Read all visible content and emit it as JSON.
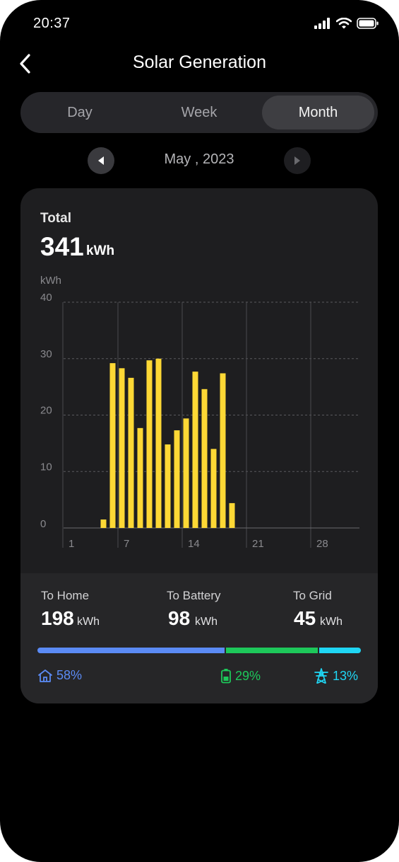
{
  "status": {
    "time": "20:37"
  },
  "header": {
    "title": "Solar Generation",
    "back_icon": "chevron-left-icon"
  },
  "tabs": [
    {
      "label": "Day",
      "active": false
    },
    {
      "label": "Week",
      "active": false
    },
    {
      "label": "Month",
      "active": true
    }
  ],
  "period": {
    "label": "May , 2023",
    "prev_icon": "triangle-left-icon",
    "next_icon": "triangle-right-icon"
  },
  "summary": {
    "title": "Total",
    "value": "341",
    "unit": "kWh"
  },
  "chart_data": {
    "type": "bar",
    "ylabel": "kWh",
    "ylim": [
      0,
      40
    ],
    "yticks": [
      "0",
      "10",
      "20",
      "30",
      "40"
    ],
    "xticks": [
      "1",
      "7",
      "14",
      "21",
      "28"
    ],
    "grid": true,
    "bar_color": "#FDD835",
    "x": [
      1,
      2,
      3,
      4,
      5,
      6,
      7,
      8,
      9,
      10,
      11,
      12,
      13,
      14,
      15,
      16,
      17,
      18,
      19,
      20,
      21,
      22,
      23,
      24,
      25,
      26,
      27,
      28,
      29,
      30,
      31
    ],
    "values": [
      0,
      0,
      0,
      0,
      1.5,
      29.2,
      28.3,
      26.6,
      17.7,
      29.7,
      30,
      14.8,
      17.3,
      19.4,
      27.7,
      24.6,
      14,
      27.4,
      4.4,
      0,
      0,
      0,
      0,
      0,
      0,
      0,
      0,
      0,
      0,
      0,
      0
    ]
  },
  "breakdown": [
    {
      "label": "To Home",
      "value": "198",
      "unit": "kWh",
      "percent": "58%",
      "share": 0.58,
      "color": "#5B8BF5",
      "icon": "home-icon"
    },
    {
      "label": "To Battery",
      "value": "98",
      "unit": "kWh",
      "percent": "29%",
      "share": 0.29,
      "color": "#1DC85A",
      "icon": "battery-icon"
    },
    {
      "label": "To Grid",
      "value": "45",
      "unit": "kWh",
      "percent": "13%",
      "share": 0.13,
      "color": "#1FD6F4",
      "icon": "power-tower-icon"
    }
  ]
}
